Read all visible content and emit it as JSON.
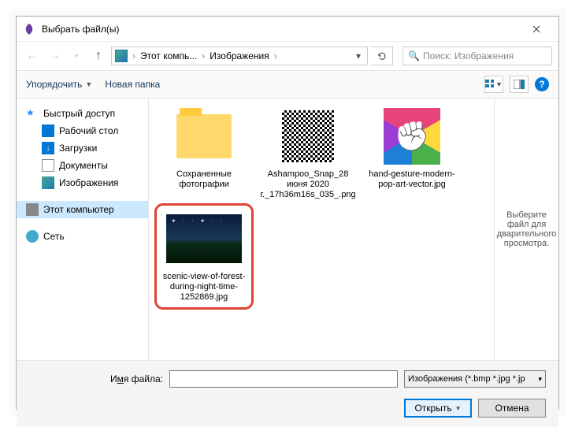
{
  "window": {
    "title": "Выбрать файл(ы)"
  },
  "breadcrumb": {
    "seg1": "Этот компь...",
    "seg2": "Изображения",
    "dropdown_glyph": "▾"
  },
  "search": {
    "placeholder": "Поиск: Изображения"
  },
  "toolbar": {
    "organize": "Упорядочить",
    "new_folder": "Новая папка"
  },
  "sidebar": {
    "quick_access": "Быстрый доступ",
    "desktop": "Рабочий стол",
    "downloads": "Загрузки",
    "documents": "Документы",
    "pictures": "Изображения",
    "this_pc": "Этот компьютер",
    "network": "Сеть"
  },
  "files": [
    {
      "name": "Сохраненные фотографии",
      "type": "folder"
    },
    {
      "name": "Ashampoo_Snap_28 июня 2020 г._17h36m16s_035_.png",
      "type": "qr"
    },
    {
      "name": "hand-gesture-modern-pop-art-vector.jpg",
      "type": "popart"
    },
    {
      "name": "scenic-view-of-forest-during-night-time-1252869.jpg",
      "type": "night",
      "selected": true
    }
  ],
  "preview": {
    "text": "Выберите файл для дварительного просмотра."
  },
  "footer": {
    "filename_label_pre": "И",
    "filename_label_u": "м",
    "filename_label_post": "я файла:",
    "filename_value": "",
    "filetype": "Изображения (*.bmp *.jpg *.jp",
    "open": "Открыть",
    "cancel": "Отмена"
  }
}
